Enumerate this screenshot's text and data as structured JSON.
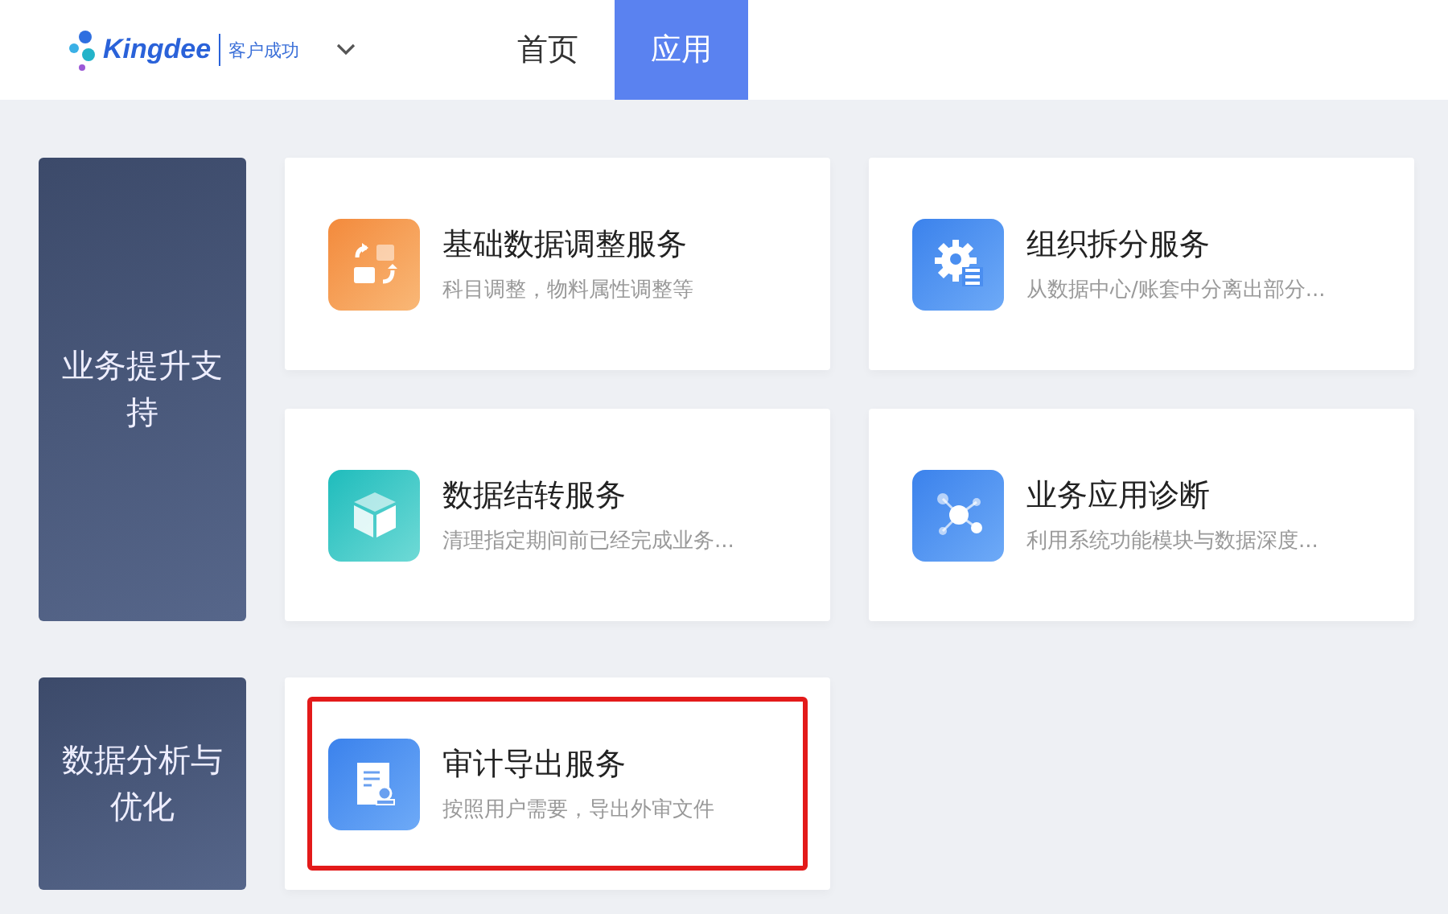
{
  "header": {
    "logo": {
      "brand": "Kingdee",
      "product": "客户成功"
    },
    "tabs": [
      {
        "label": "首页",
        "selected": false
      },
      {
        "label": "应用",
        "selected": true
      }
    ]
  },
  "sections": [
    {
      "category": "业务提升支持",
      "services": [
        {
          "title": "基础数据调整服务",
          "description": "科目调整，物料属性调整等",
          "kind": "swap",
          "highlighted": false
        },
        {
          "title": "组织拆分服务",
          "description": "从数据中心/账套中分离出部分...",
          "kind": "gear",
          "highlighted": false
        },
        {
          "title": "数据结转服务",
          "description": "清理指定期间前已经完成业务...",
          "kind": "cube",
          "highlighted": false
        },
        {
          "title": "业务应用诊断",
          "description": "利用系统功能模块与数据深度...",
          "kind": "network",
          "highlighted": false
        }
      ]
    },
    {
      "category": "数据分析与优化",
      "services": [
        {
          "title": "审计导出服务",
          "description": "按照用户需要，导出外审文件",
          "kind": "document",
          "highlighted": true
        }
      ]
    }
  ]
}
